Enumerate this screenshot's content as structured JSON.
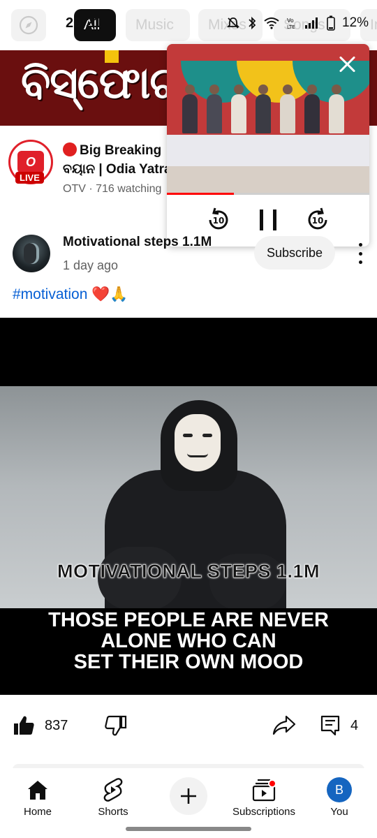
{
  "status_bar": {
    "time": "20:21",
    "battery": "12%",
    "icons": [
      "mute-icon",
      "bluetooth-icon",
      "wifi-icon",
      "volte-icon",
      "signal-icon",
      "battery-icon"
    ]
  },
  "chips": {
    "explore_icon": "compass-icon",
    "items": [
      {
        "label": "All",
        "selected": true
      },
      {
        "label": "Music",
        "selected": false
      },
      {
        "label": "Mixes",
        "selected": false
      },
      {
        "label": "Songs",
        "selected": false
      },
      {
        "label": "In",
        "selected": false
      }
    ]
  },
  "live_item": {
    "thumbnail_text": "ବିସ୍ଫୋଟ",
    "channel_logo_text": "O",
    "live_badge": "LIVE",
    "title_line1": "Big Breaking",
    "title_line2": "ବୟାନ | Odia Yatra",
    "meta": "OTV · 716 watching"
  },
  "mini_player": {
    "progress_fraction": 0.33,
    "rewind_label": "10",
    "forward_label": "10",
    "accent_color": "#ff0000"
  },
  "post": {
    "channel_name": "Motivational steps 1.1M",
    "time_ago": "1 day ago",
    "subscribe_label": "Subscribe",
    "hashtag": "#motivation",
    "hashtag_emojis": "❤️🙏",
    "image_watermark": "MOTIVATIONAL STEPS 1.1M",
    "image_quote": [
      "THOSE PEOPLE ARE NEVER",
      "ALONE WHO CAN",
      "SET THEIR OWN MOOD"
    ]
  },
  "actions": {
    "likes": "837",
    "comments": "4"
  },
  "bottom_nav": {
    "items": [
      {
        "label": "Home",
        "icon": "home-icon"
      },
      {
        "label": "Shorts",
        "icon": "shorts-icon"
      },
      {
        "label": "",
        "icon": "plus-icon"
      },
      {
        "label": "Subscriptions",
        "icon": "subscriptions-icon"
      },
      {
        "label": "You",
        "icon": "avatar"
      }
    ],
    "avatar_letter": "B"
  }
}
